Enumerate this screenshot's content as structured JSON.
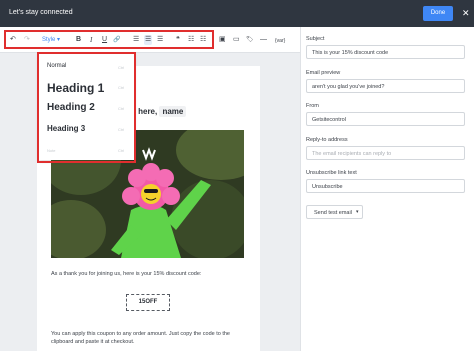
{
  "window": {
    "title": "Let's stay connected",
    "done_label": "Done",
    "close_glyph": "✕"
  },
  "toolbar": {
    "undo": "↶",
    "redo": "↷",
    "style_label": "Style",
    "style_chevron": "▾",
    "bold": "B",
    "italic": "I",
    "underline": "U",
    "link": "🔗",
    "align_left": "☰",
    "align_center": "☰",
    "align_right": "☰",
    "quote": "❝",
    "bullet_list": "☷",
    "numbered_list": "☷",
    "image": "▣",
    "button": "▭",
    "tag": "🏷",
    "divider": "—",
    "variable": "{var}",
    "highlight_color": "#e02e2e"
  },
  "style_menu": {
    "items": [
      {
        "label": "Normal",
        "shortcut": "Ctrl"
      },
      {
        "label": "Heading 1",
        "shortcut": "Ctrl"
      },
      {
        "label": "Heading 2",
        "shortcut": "Ctrl"
      },
      {
        "label": "Heading 3",
        "shortcut": "Ctrl"
      },
      {
        "label": "Note",
        "shortcut": "Ctrl"
      }
    ]
  },
  "email": {
    "greeting_prefix": "u here,",
    "greeting_tag": "name",
    "photo_alt": "person in pink flower costume",
    "thanks_text": "As a thank you for joining us, here is your 15% discount code:",
    "coupon_code": "15OFF",
    "apply_text": "You can apply this coupon to any order amount. Just copy the code to the clipboard and paste it at checkout."
  },
  "settings": {
    "subject_label": "Subject",
    "subject_value": "This is your 15% discount code",
    "preview_label": "Email preview",
    "preview_value": "aren't you glad you've joined?",
    "from_label": "From",
    "from_value": "Getsitecontrol",
    "reply_label": "Reply-to address",
    "reply_placeholder": "The email recipients can reply to",
    "unsubscribe_label": "Unsubscribe link text",
    "unsubscribe_value": "Unsubscribe",
    "send_test_label": "Send test email",
    "send_test_chevron": "▾"
  },
  "colors": {
    "topbar": "#2f3640",
    "accent": "#3f87f5",
    "highlight": "#e02e2e"
  }
}
